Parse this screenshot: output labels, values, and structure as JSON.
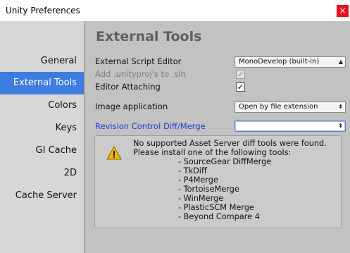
{
  "window": {
    "title": "Unity Preferences",
    "close_glyph": "×"
  },
  "sidebar": {
    "items": [
      {
        "label": "General"
      },
      {
        "label": "External Tools",
        "selected": true
      },
      {
        "label": "Colors"
      },
      {
        "label": "Keys"
      },
      {
        "label": "GI Cache"
      },
      {
        "label": "2D"
      },
      {
        "label": "Cache Server"
      }
    ]
  },
  "main": {
    "heading": "External Tools",
    "external_script_editor": {
      "label": "External Script Editor",
      "value": "MonoDevelop (built-in)"
    },
    "add_unityproj": {
      "label": "Add .unityproj's to .sln",
      "checked": true,
      "enabled": false
    },
    "editor_attaching": {
      "label": "Editor Attaching",
      "checked": true
    },
    "image_application": {
      "label": "Image application",
      "value": "Open by file extension"
    },
    "revision_control": {
      "label": "Revision Control Diff/Merge",
      "value": ""
    },
    "help": {
      "icon": "warning-icon",
      "line1": "No supported Asset Server diff tools were found.",
      "line2": "Please install one of the following tools:",
      "tools": [
        "- SourceGear DiffMerge",
        "- TkDiff",
        "- P4Merge",
        "- TortoiseMerge",
        "- WinMerge",
        "- PlasticSCM Merge",
        "- Beyond Compare 4"
      ]
    }
  },
  "colors": {
    "selection": "#3e7ce0",
    "link_label": "#1a3fd4",
    "warning": "#f5b800"
  }
}
